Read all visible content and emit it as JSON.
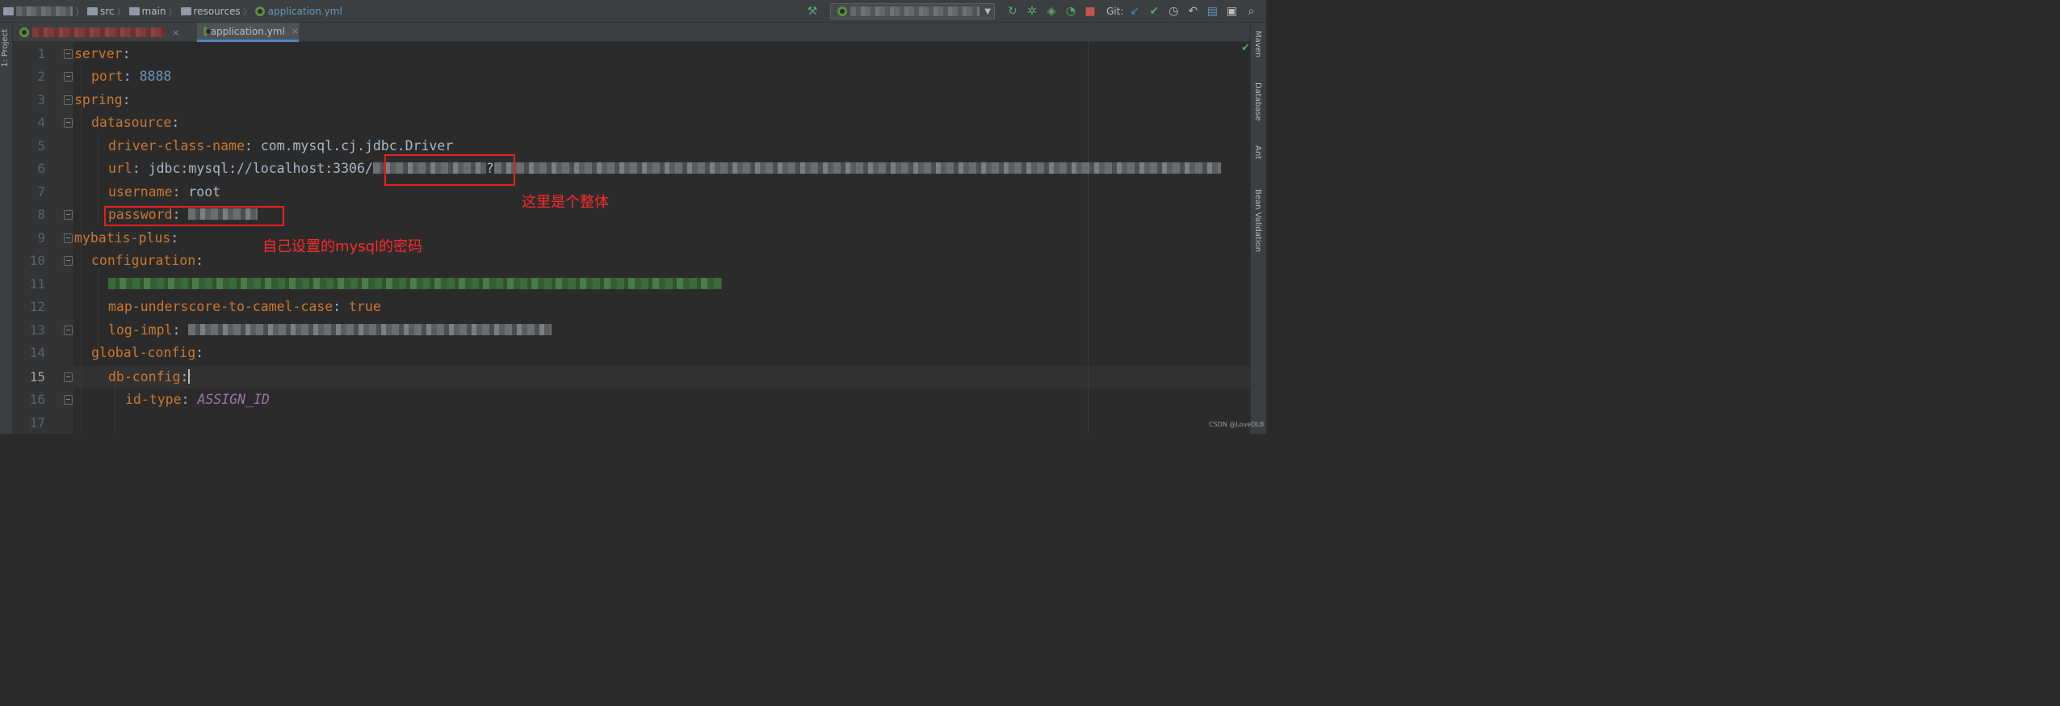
{
  "breadcrumbs": {
    "items": [
      "src",
      "main",
      "resources"
    ],
    "file": "application.yml"
  },
  "toolbar": {
    "git_label": "Git:",
    "icons": [
      "hammer-icon",
      "run-icon",
      "debug-icon",
      "coverage-icon",
      "profile-icon",
      "stop-icon",
      "git-update-icon",
      "git-commit-icon",
      "history-icon",
      "revert-icon",
      "project-structure-icon",
      "terminal-icon",
      "search-icon"
    ]
  },
  "left_strip": {
    "project_label": "1: Project"
  },
  "right_strip": {
    "labels": [
      "Maven",
      "Database",
      "Ant",
      "Bean Validation"
    ]
  },
  "tabs": [
    {
      "label": "",
      "close": "×",
      "active": false
    },
    {
      "label": "application.yml",
      "close": "×",
      "active": true
    }
  ],
  "editor": {
    "lines": [
      {
        "num": "1",
        "key": "server",
        "colon": ":",
        "val": ""
      },
      {
        "num": "2",
        "key": "port",
        "colon": ":",
        "val": "8888"
      },
      {
        "num": "3",
        "key": "spring",
        "colon": ":",
        "val": ""
      },
      {
        "num": "4",
        "key": "datasource",
        "colon": ":",
        "val": ""
      },
      {
        "num": "5",
        "key": "driver-class-name",
        "colon": ":",
        "val": "com.mysql.cj.jdbc.Driver"
      },
      {
        "num": "6",
        "key": "url",
        "colon": ":",
        "val": "jdbc:mysql://localhost:3306/",
        "val2": "?"
      },
      {
        "num": "7",
        "key": "username",
        "colon": ":",
        "val": "root"
      },
      {
        "num": "8",
        "key": "password",
        "colon": ":",
        "val": ""
      },
      {
        "num": "9",
        "key": "mybatis-plus",
        "colon": ":",
        "val": ""
      },
      {
        "num": "10",
        "key": "configuration",
        "colon": ":",
        "val": ""
      },
      {
        "num": "11",
        "key": "",
        "colon": "",
        "val": ""
      },
      {
        "num": "12",
        "key": "map-underscore-to-camel-case",
        "colon": ":",
        "val": "true"
      },
      {
        "num": "13",
        "key": "log-impl",
        "colon": ":",
        "val": ""
      },
      {
        "num": "14",
        "key": "global-config",
        "colon": ":",
        "val": ""
      },
      {
        "num": "15",
        "key": "db-config",
        "colon": ":",
        "val": ""
      },
      {
        "num": "16",
        "key": "id-type",
        "colon": ":",
        "val": "ASSIGN_ID"
      },
      {
        "num": "17",
        "key": "",
        "colon": "",
        "val": ""
      }
    ]
  },
  "annotations": {
    "url_note": "这里是个整体",
    "password_note": "自己设置的mysql的密码",
    "color": "#e82020"
  },
  "watermark": "CSDN @LoveDLB"
}
